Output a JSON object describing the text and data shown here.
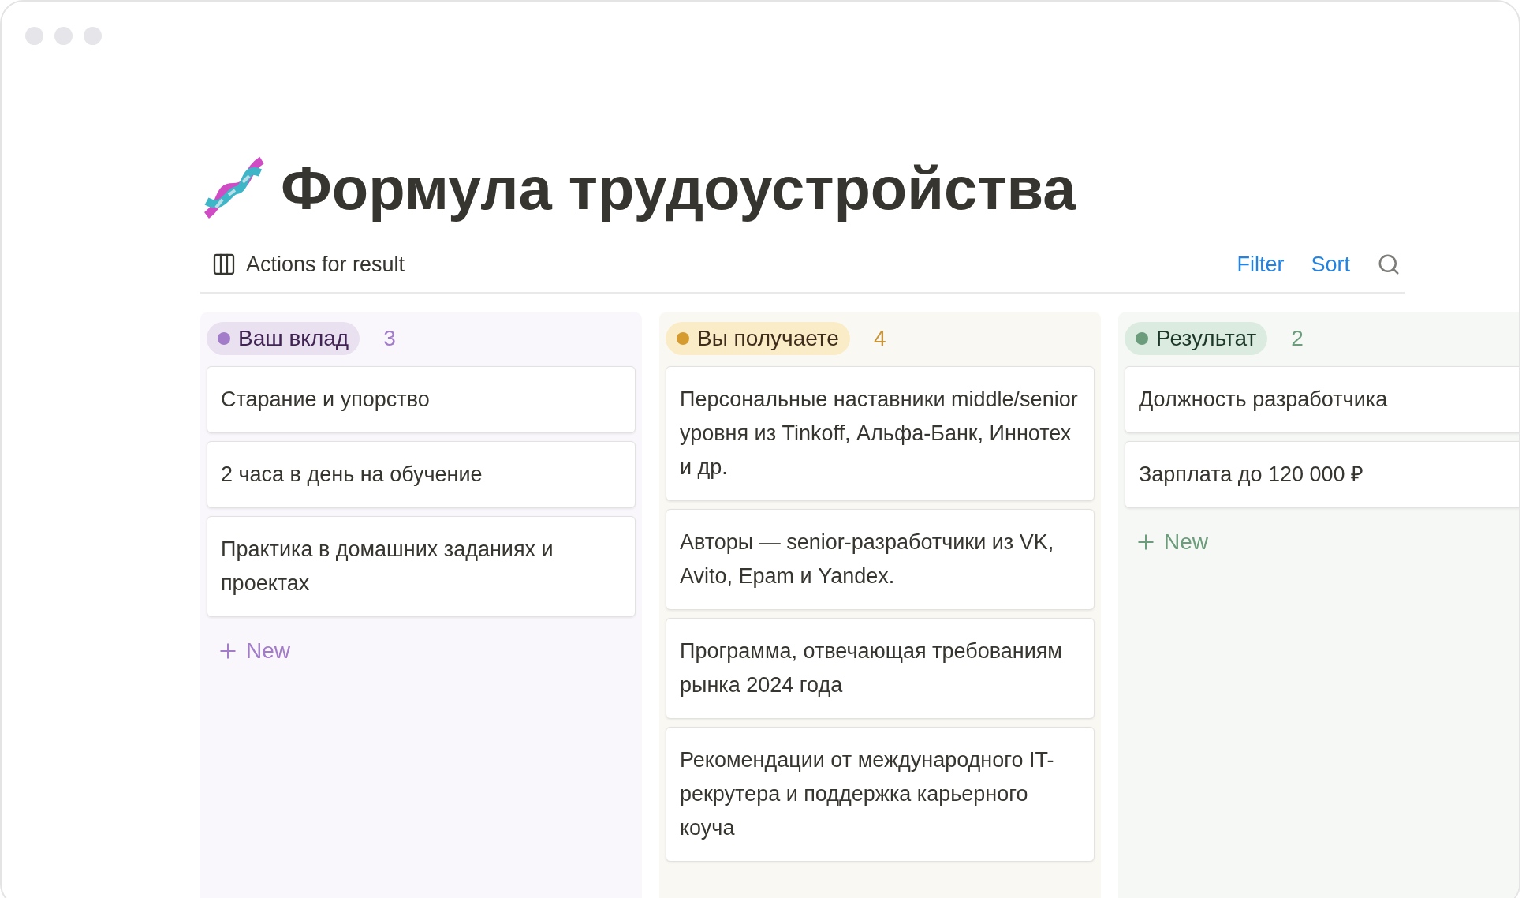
{
  "title": "Формула трудоустройства",
  "view": {
    "label": "Actions for result"
  },
  "toolbar": {
    "filter": "Filter",
    "sort": "Sort"
  },
  "columns": [
    {
      "name": "Ваш вклад",
      "count": "3",
      "color": "#a27cc9",
      "cards": [
        "Старание и упорство",
        "2 часа в день на обучение",
        "Практика в домашних заданиях и проектах"
      ],
      "new_label": "New"
    },
    {
      "name": "Вы получаете",
      "count": "4",
      "color": "#d69b2e",
      "cards": [
        "Персональные наставники middle/senior уровня из Tinkoff, Альфа-Банк, Иннотех и др.",
        "Авторы — senior-разработчики из VK, Avito, Epam и Yandex.",
        "Программа, отвечающая требованиям рынка 2024 года",
        "Рекомендации от международного IT-рекрутера и поддержка карьерного коуча"
      ]
    },
    {
      "name": "Результат",
      "count": "2",
      "color": "#6b9c7c",
      "cards": [
        "Должность разработчика",
        "Зарплата до 120 000 ₽"
      ],
      "new_label": "New"
    }
  ]
}
